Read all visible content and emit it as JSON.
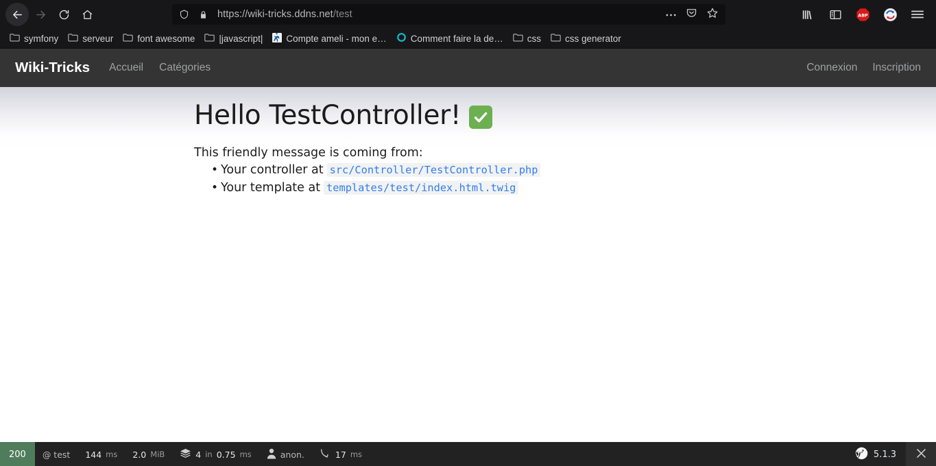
{
  "browser": {
    "nav": {
      "back_icon": "back-arrow-icon",
      "forward_icon": "forward-arrow-icon",
      "reload_icon": "reload-icon",
      "home_icon": "home-icon"
    },
    "urlbar": {
      "shield_icon": "shield-icon",
      "lock_icon": "lock-icon",
      "url_scheme_host": "https://wiki-tricks.ddns.net",
      "url_path": "/test",
      "full_url": "https://wiki-tricks.ddns.net/test",
      "page_actions_icon": "ellipsis-icon",
      "pocket_icon": "pocket-icon",
      "bookmark_star_icon": "star-icon"
    },
    "toolbar_right": [
      {
        "name": "library-icon",
        "label": "Library"
      },
      {
        "name": "sidebar-icon",
        "label": "Sidebars"
      },
      {
        "name": "adblock-plus-icon",
        "label": "ABP"
      },
      {
        "name": "sync-extension-icon",
        "label": "Extension"
      },
      {
        "name": "hamburger-menu-icon",
        "label": "Open menu"
      }
    ],
    "bookmarks": [
      {
        "label": "symfony",
        "icon": "folder-icon"
      },
      {
        "label": "serveur",
        "icon": "folder-icon"
      },
      {
        "label": "font awesome",
        "icon": "folder-icon"
      },
      {
        "label": "|javascript|",
        "icon": "folder-icon"
      },
      {
        "label": "Compte ameli - mon e…",
        "icon": "ameli-favicon"
      },
      {
        "label": "Comment faire la de…",
        "icon": "teal-ring-favicon"
      },
      {
        "label": "css",
        "icon": "folder-icon"
      },
      {
        "label": "css generator",
        "icon": "folder-icon"
      }
    ]
  },
  "site": {
    "brand": "Wiki-Tricks",
    "nav_left": [
      {
        "label": "Accueil"
      },
      {
        "label": "Catégories"
      }
    ],
    "nav_right": [
      {
        "label": "Connexion"
      },
      {
        "label": "Inscription"
      }
    ]
  },
  "page": {
    "title": "Hello TestController!",
    "title_emoji": "white-heavy-check-mark",
    "lead": "This friendly message is coming from:",
    "origins": [
      {
        "text": "Your controller at",
        "path": "src/Controller/TestController.php"
      },
      {
        "text": "Your template at",
        "path": "templates/test/index.html.twig"
      }
    ]
  },
  "sf_toolbar": {
    "status_code": "200",
    "route": "@ test",
    "time_value": "144",
    "time_unit": "ms",
    "memory_value": "2.0",
    "memory_unit": "MiB",
    "templates_icon": "layers-icon",
    "templates_count": "4",
    "templates_in": "in",
    "templates_time": "0.75",
    "templates_unit": "ms",
    "user_icon": "user-icon",
    "user": "anon.",
    "forward_icon": "curved-arrow-icon",
    "forward_time": "17",
    "forward_unit": "ms",
    "symfony_icon": "symfony-logo-icon",
    "version": "5.1.3",
    "close_icon": "close-icon",
    "status_color": "#4f7d5c"
  }
}
